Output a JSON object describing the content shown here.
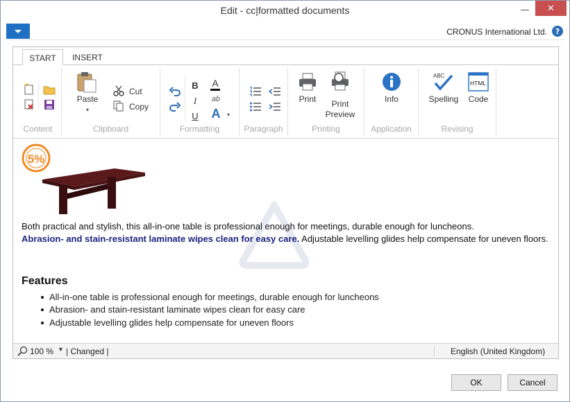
{
  "window": {
    "title": "Edit - cc|formatted documents",
    "minimize_glyph": "—",
    "maximize_glyph": "□",
    "close_glyph": "✕"
  },
  "topbar": {
    "company": "CRONUS International Ltd.",
    "help_glyph": "?"
  },
  "tabs": [
    {
      "label": "START"
    },
    {
      "label": "INSERT"
    }
  ],
  "ribbon": {
    "groups": {
      "content": "Content",
      "clipboard": "Clipboard",
      "formatting": "Formatting",
      "paragraph": "Paragraph",
      "printing": "Printing",
      "application": "Application",
      "revising": "Revising"
    },
    "buttons": {
      "paste": "Paste",
      "cut": "Cut",
      "copy": "Copy",
      "print": "Print",
      "print_preview_1": "Print",
      "print_preview_2": "Preview",
      "info": "Info",
      "spelling": "Spelling",
      "code": "Code"
    },
    "glyphs": {
      "bold": "B",
      "italic": "I",
      "underline": "U",
      "font_color": "A",
      "highlight": "ab",
      "font_size": "A",
      "spelling_abc": "ABC",
      "code_html": "HTML",
      "info_i": "i"
    },
    "icons": [
      "new-doc-icon",
      "delete-doc-icon",
      "open-folder-icon",
      "save-icon",
      "paste-icon",
      "cut-icon",
      "copy-icon",
      "undo-icon",
      "redo-icon",
      "numbered-list-icon",
      "bullet-list-icon",
      "indent-decrease-icon",
      "indent-increase-icon",
      "printer-icon",
      "print-preview-icon",
      "info-icon",
      "spelling-check-icon",
      "html-code-icon"
    ]
  },
  "document": {
    "badge_text": "5%",
    "paragraph_line1": "Both practical and stylish, this all-in-one table is professional enough for meetings, durable enough for luncheons.",
    "paragraph_bold": "Abrasion- and stain-resistant laminate wipes clean for easy care.",
    "paragraph_rest": "  Adjustable levelling glides help compensate for uneven floors.",
    "features_heading": "Features",
    "features": [
      "All-in-one table is professional enough for meetings, durable enough for luncheons",
      "Abrasion- and stain-resistant laminate wipes clean for easy care",
      "Adjustable levelling glides help compensate for uneven floors"
    ]
  },
  "statusbar": {
    "zoom": "100 %",
    "changed": "| Changed |",
    "language": "English (United Kingdom)"
  },
  "dialog_buttons": {
    "ok": "OK",
    "cancel": "Cancel"
  },
  "colors": {
    "accent": "#1f6fc5",
    "heading_blue": "#1a237e",
    "close_red": "#c74f4f",
    "badge_orange": "#f08a24"
  }
}
